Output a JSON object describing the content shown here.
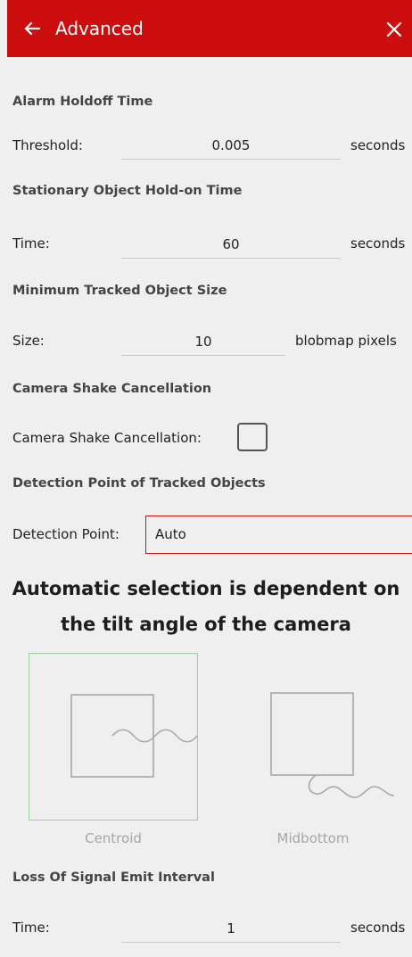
{
  "header": {
    "title": "Advanced"
  },
  "alarm_holdoff": {
    "section_title": "Alarm Holdoff Time",
    "label": "Threshold:",
    "value": "0.005",
    "unit": "seconds"
  },
  "stationary": {
    "section_title": "Stationary Object Hold-on Time",
    "label": "Time:",
    "value": "60",
    "unit": "seconds"
  },
  "min_size": {
    "section_title": "Minimum Tracked Object Size",
    "label": "Size:",
    "value": "10",
    "unit": "blobmap pixels"
  },
  "camera_shake": {
    "section_title": "Camera Shake Cancellation",
    "label": "Camera Shake Cancellation:",
    "checked": false
  },
  "detection_point": {
    "section_title": "Detection Point of Tracked Objects",
    "label": "Detection Point:",
    "selected": "Auto",
    "heading_line1": "Automatic selection is dependent on",
    "heading_line2": "the tilt angle of the camera",
    "options": [
      {
        "label": "Centroid",
        "highlighted": true
      },
      {
        "label": "Midbottom",
        "highlighted": false
      }
    ]
  },
  "loss_of_signal": {
    "section_title": "Loss Of Signal Emit Interval",
    "label": "Time:",
    "value": "1",
    "unit": "seconds"
  },
  "colors": {
    "header": "#cc0e0e",
    "select_border": "#cc0e0e",
    "highlight": "#9fd49f"
  }
}
